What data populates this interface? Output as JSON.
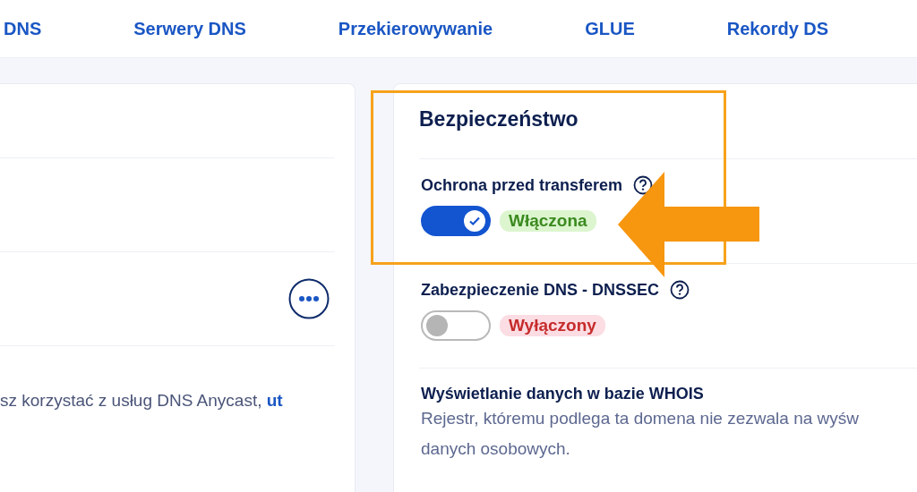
{
  "tabs": [
    {
      "label": "DNS"
    },
    {
      "label": "Serwery DNS"
    },
    {
      "label": "Przekierowywanie"
    },
    {
      "label": "GLUE"
    },
    {
      "label": "Rekordy DS"
    }
  ],
  "left_card": {
    "note": "sz korzystać z usług DNS Anycast,",
    "note_link": "ut"
  },
  "security": {
    "title": "Bezpieczeństwo",
    "items": [
      {
        "kind": "toggle",
        "label": "Ochrona przed transferem",
        "on": true,
        "status": "Włączona"
      },
      {
        "kind": "toggle",
        "label": "Zabezpieczenie DNS - DNSSEC",
        "on": false,
        "status": "Wyłączony"
      },
      {
        "kind": "text",
        "label": "Wyświetlanie danych w bazie WHOIS",
        "description_lines": [
          "Rejestr, któremu podlega ta domena nie zezwala na wyśw",
          "danych osobowych."
        ]
      }
    ]
  }
}
